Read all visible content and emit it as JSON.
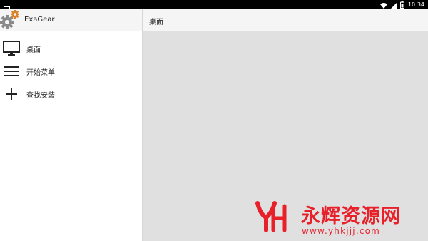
{
  "status_bar": {
    "time": "10:34",
    "icons": [
      "image-notification-icon",
      "wifi-icon",
      "signal-icon",
      "battery-icon"
    ]
  },
  "drawer": {
    "app_name": "ExaGear",
    "items": [
      {
        "label": "桌面",
        "icon": "monitor-icon"
      },
      {
        "label": "开始菜单",
        "icon": "menu-icon"
      },
      {
        "label": "查找安装",
        "icon": "plus-icon"
      }
    ]
  },
  "content": {
    "title": "桌面"
  },
  "watermark": {
    "title": "永辉资源网",
    "url": "www.yhkjjj.com"
  },
  "colors": {
    "status_bar": "#000000",
    "header_bg": "#f5f5f5",
    "content_bg": "#e0e0e0",
    "watermark": "#e8202a",
    "gear_orange": "#d9822b",
    "gear_gray": "#8a8a8a"
  }
}
